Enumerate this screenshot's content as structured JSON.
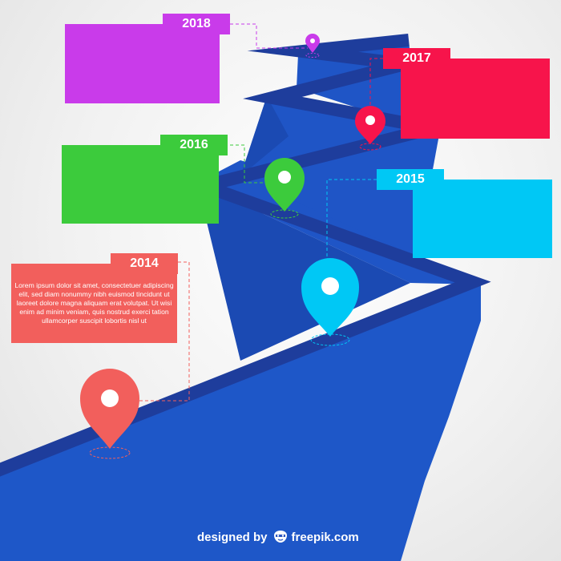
{
  "milestones": [
    {
      "year": "2014",
      "color": "#f25f5c",
      "text": "Lorem ipsum dolor sit amet, consectetuer adipiscing elit, sed diam nonummy nibh euismod tincidunt ut laoreet dolore magna aliquam erat volutpat. Ut wisi enim ad minim veniam, quis nostrud exerci tation ullamcorper suscipit lobortis nisl ut"
    },
    {
      "year": "2015",
      "color": "#00c8f5",
      "text": ""
    },
    {
      "year": "2016",
      "color": "#3ccb3c",
      "text": ""
    },
    {
      "year": "2017",
      "color": "#f7144b",
      "text": ""
    },
    {
      "year": "2018",
      "color": "#c93bea",
      "text": ""
    }
  ],
  "colors": {
    "road_top": "#1e3d9c",
    "road_side": "#1e57c8",
    "road_side_dark": "#1b4ab3",
    "background": "#eeeeee"
  },
  "footer": {
    "designed_by": "designed by",
    "brand": "freepik.com",
    "icon": "freepik-face-icon"
  }
}
